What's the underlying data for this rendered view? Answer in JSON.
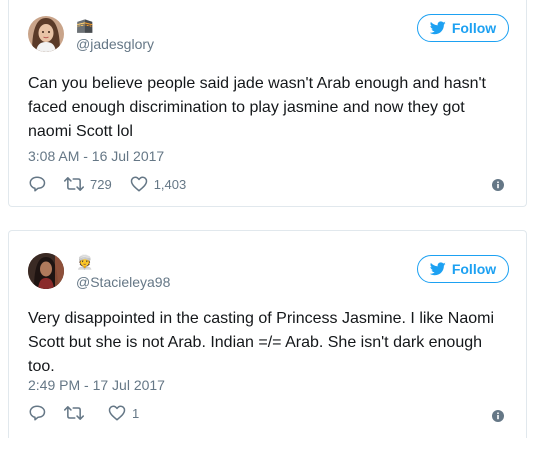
{
  "tweets": [
    {
      "avatar_icon": "user-avatar-photo",
      "badge_emoji": "🕋",
      "handle": "@jadesglory",
      "follow_label": "Follow",
      "text": "Can you believe people said jade wasn't Arab enough and hasn't faced enough discrimination to play jasmine and now they got naomi Scott lol",
      "timestamp": "3:08 AM - 16 Jul 2017",
      "retweets": "729",
      "likes": "1,403"
    },
    {
      "avatar_icon": "user-avatar-photo",
      "badge_emoji": "👳",
      "handle": "@Stacieleya98",
      "follow_label": "Follow",
      "text": "Very disappointed in the casting of Princess Jasmine. I like Naomi Scott but she is not Arab. Indian =/= Arab. She isn't dark enough too.",
      "timestamp": "2:49 PM - 17 Jul 2017",
      "retweets": "",
      "likes": "1"
    }
  ],
  "colors": {
    "accent": "#1da1f2",
    "muted": "#657786",
    "border": "#e1e8ed",
    "text": "#14171a"
  }
}
